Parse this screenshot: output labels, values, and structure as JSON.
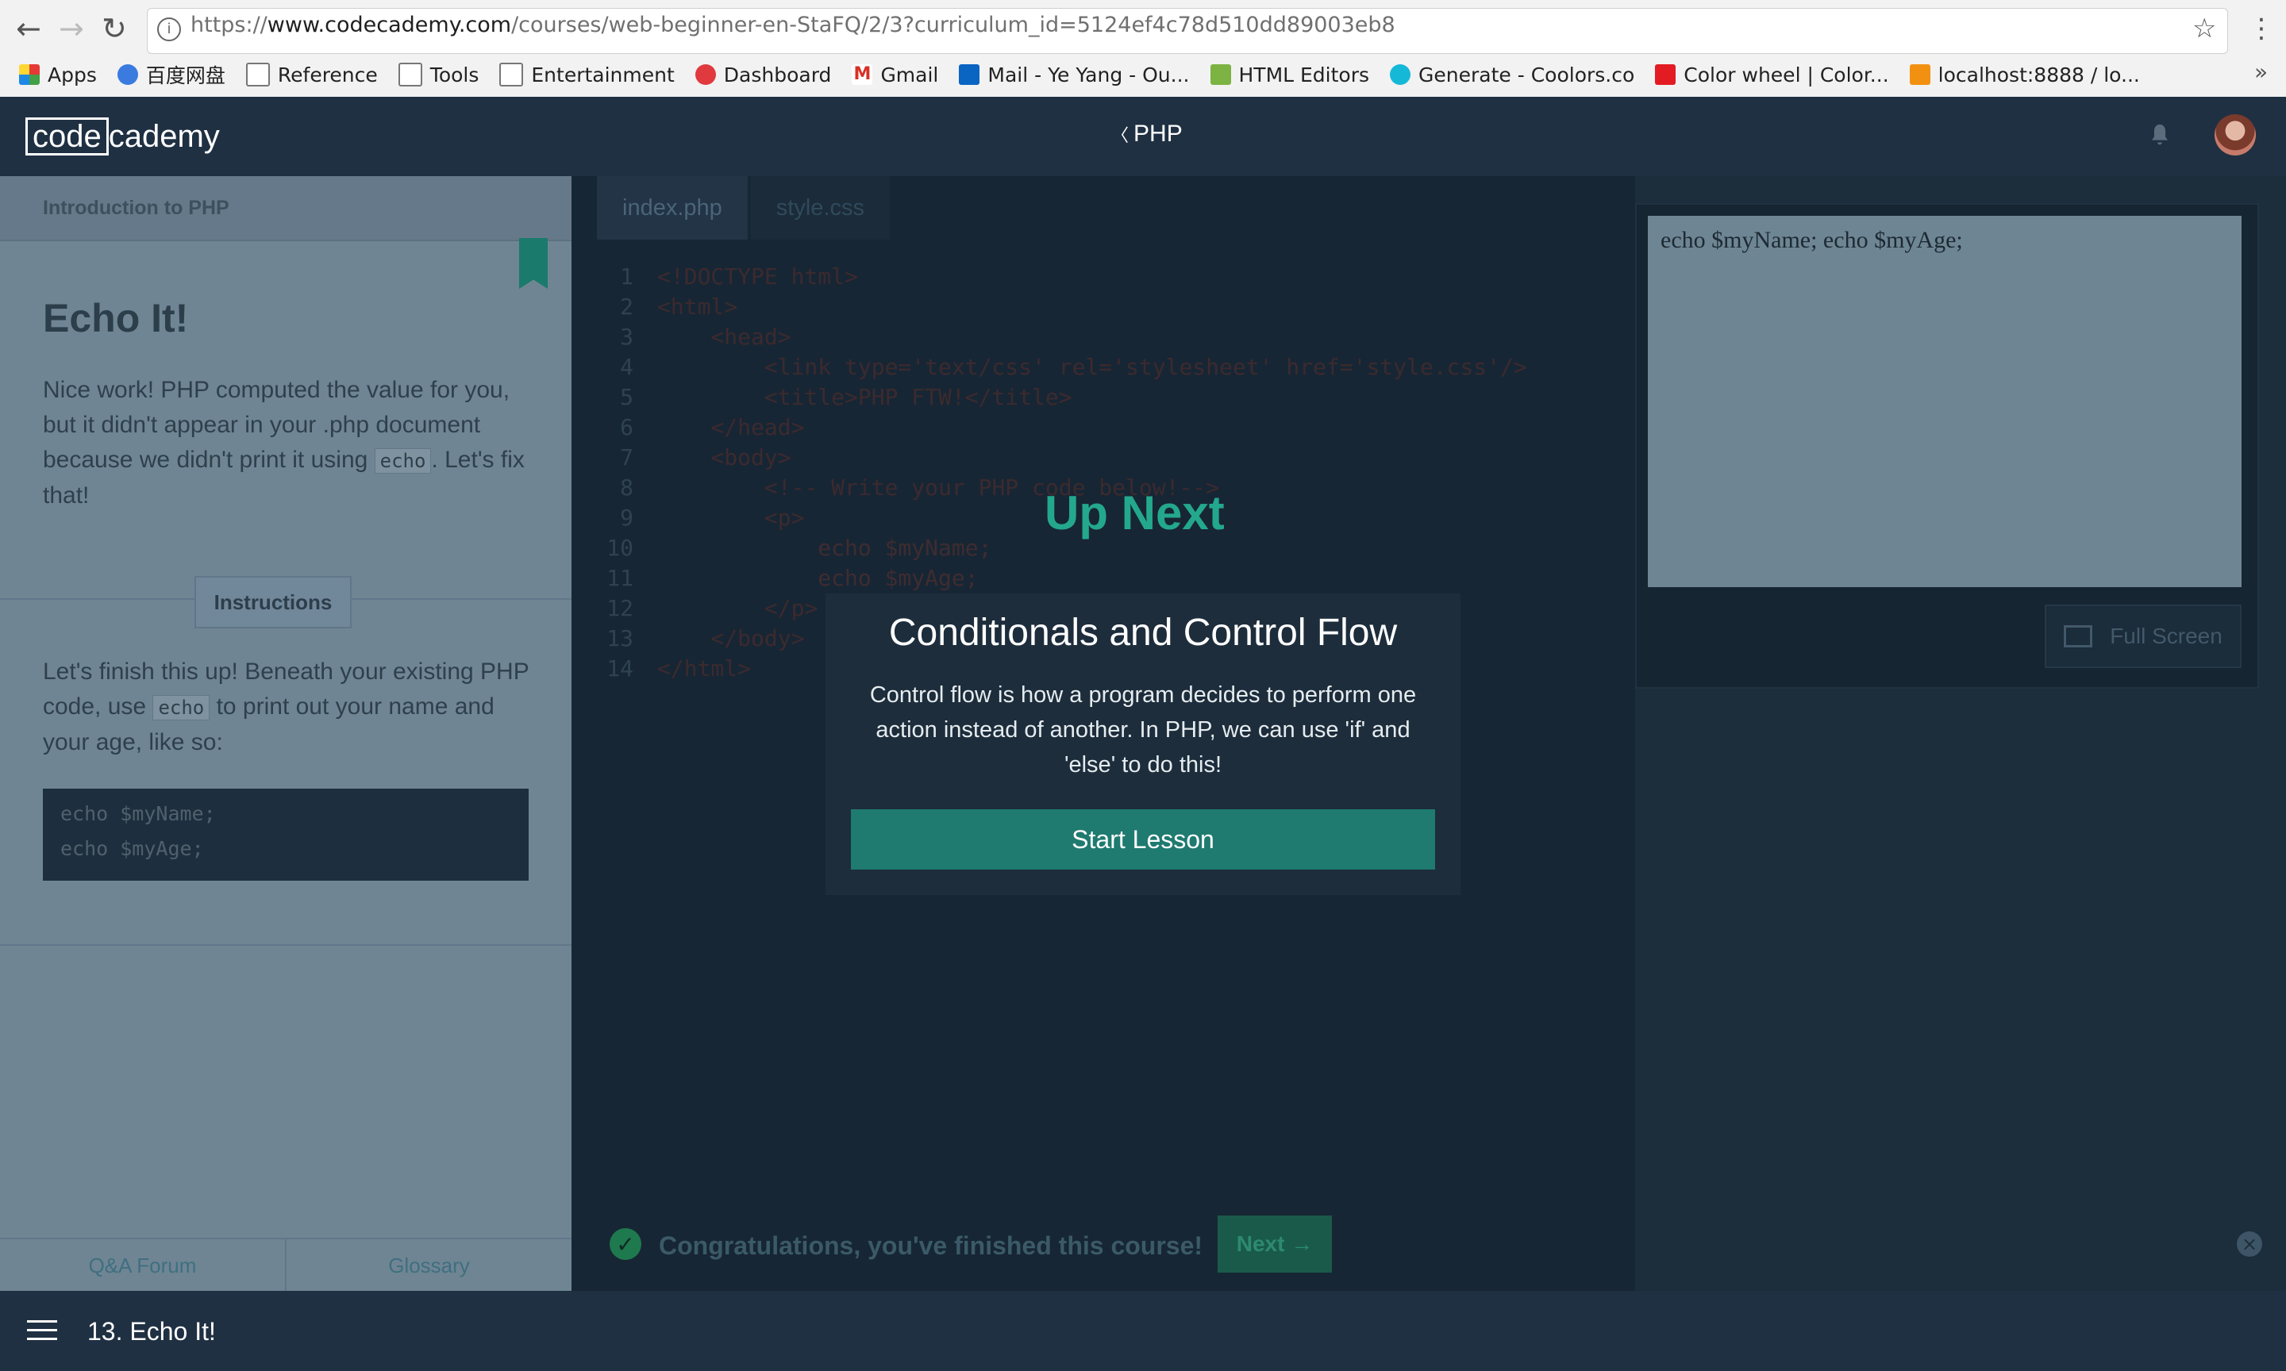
{
  "browser": {
    "url_prefix": "https://",
    "url_domain": "www.codecademy.com",
    "url_path": "/courses/web-beginner-en-StaFQ/2/3?curriculum_id=5124ef4c78d510dd89003eb8",
    "bookmarks": [
      {
        "label": "Apps",
        "icon": "apps-grid-icon"
      },
      {
        "label": "百度网盘",
        "icon": "cloud-icon"
      },
      {
        "label": "Reference",
        "icon": "folder-icon"
      },
      {
        "label": "Tools",
        "icon": "folder-icon"
      },
      {
        "label": "Entertainment",
        "icon": "folder-icon"
      },
      {
        "label": "Dashboard",
        "icon": "dashboard-icon"
      },
      {
        "label": "Gmail",
        "icon": "gmail-icon"
      },
      {
        "label": "Mail - Ye Yang - Ou...",
        "icon": "outlook-icon"
      },
      {
        "label": "HTML Editors",
        "icon": "html-icon"
      },
      {
        "label": "Generate - Coolors.co",
        "icon": "coolors-icon"
      },
      {
        "label": "Color wheel | Color...",
        "icon": "adobe-icon"
      },
      {
        "label": "localhost:8888 / lo...",
        "icon": "phpmyadmin-icon"
      }
    ],
    "more_label": "»"
  },
  "header": {
    "logo_code": "code",
    "logo_academy": "cademy",
    "course_back": "〈",
    "course_title": "PHP"
  },
  "lesson": {
    "breadcrumb": "Introduction to PHP",
    "title": "Echo It!",
    "intro_1": "Nice work! PHP computed the value for you, but it didn't appear in your .php document because we didn't print it using",
    "intro_code": "echo",
    "intro_2": ". Let's fix that!",
    "instructions_label": "Instructions",
    "instr_1": "Let's finish this up! Beneath your existing PHP code, use",
    "instr_code": "echo",
    "instr_2": "to print out your name and your age, like so:",
    "code_line_1": "echo $myName;",
    "code_line_2": "echo $myAge;",
    "qa_forum": "Q&A Forum",
    "glossary": "Glossary"
  },
  "editor": {
    "tabs": [
      "index.php",
      "style.css"
    ],
    "lines": [
      "<!DOCTYPE html>",
      "<html>",
      "    <head>",
      "        <link type='text/css' rel='stylesheet' href='style.css'/>",
      "        <title>PHP FTW!</title>",
      "    </head>",
      "    <body>",
      "        <!-- Write your PHP code below!-->",
      "        <p>",
      "            echo $myName;",
      "            echo $myAge;",
      "        </p>",
      "    </body>",
      "</html>"
    ]
  },
  "preview": {
    "output": "echo $myName; echo $myAge;",
    "fullscreen_label": "Full Screen"
  },
  "congrats": {
    "message": "Congratulations, you've finished this course!",
    "next_label": "Next →",
    "close": "×"
  },
  "modal": {
    "up_next": "Up Next",
    "title": "Conditionals and Control Flow",
    "description": "Control flow is how a program decides to perform one action instead of another. In PHP, we can use 'if' and 'else' to do this!",
    "start_label": "Start Lesson"
  },
  "footer": {
    "lesson_label": "13. Echo It!"
  },
  "colors": {
    "brand_teal": "#24a88d",
    "header_bg": "#1f3042",
    "start_button": "#1f7a70"
  }
}
